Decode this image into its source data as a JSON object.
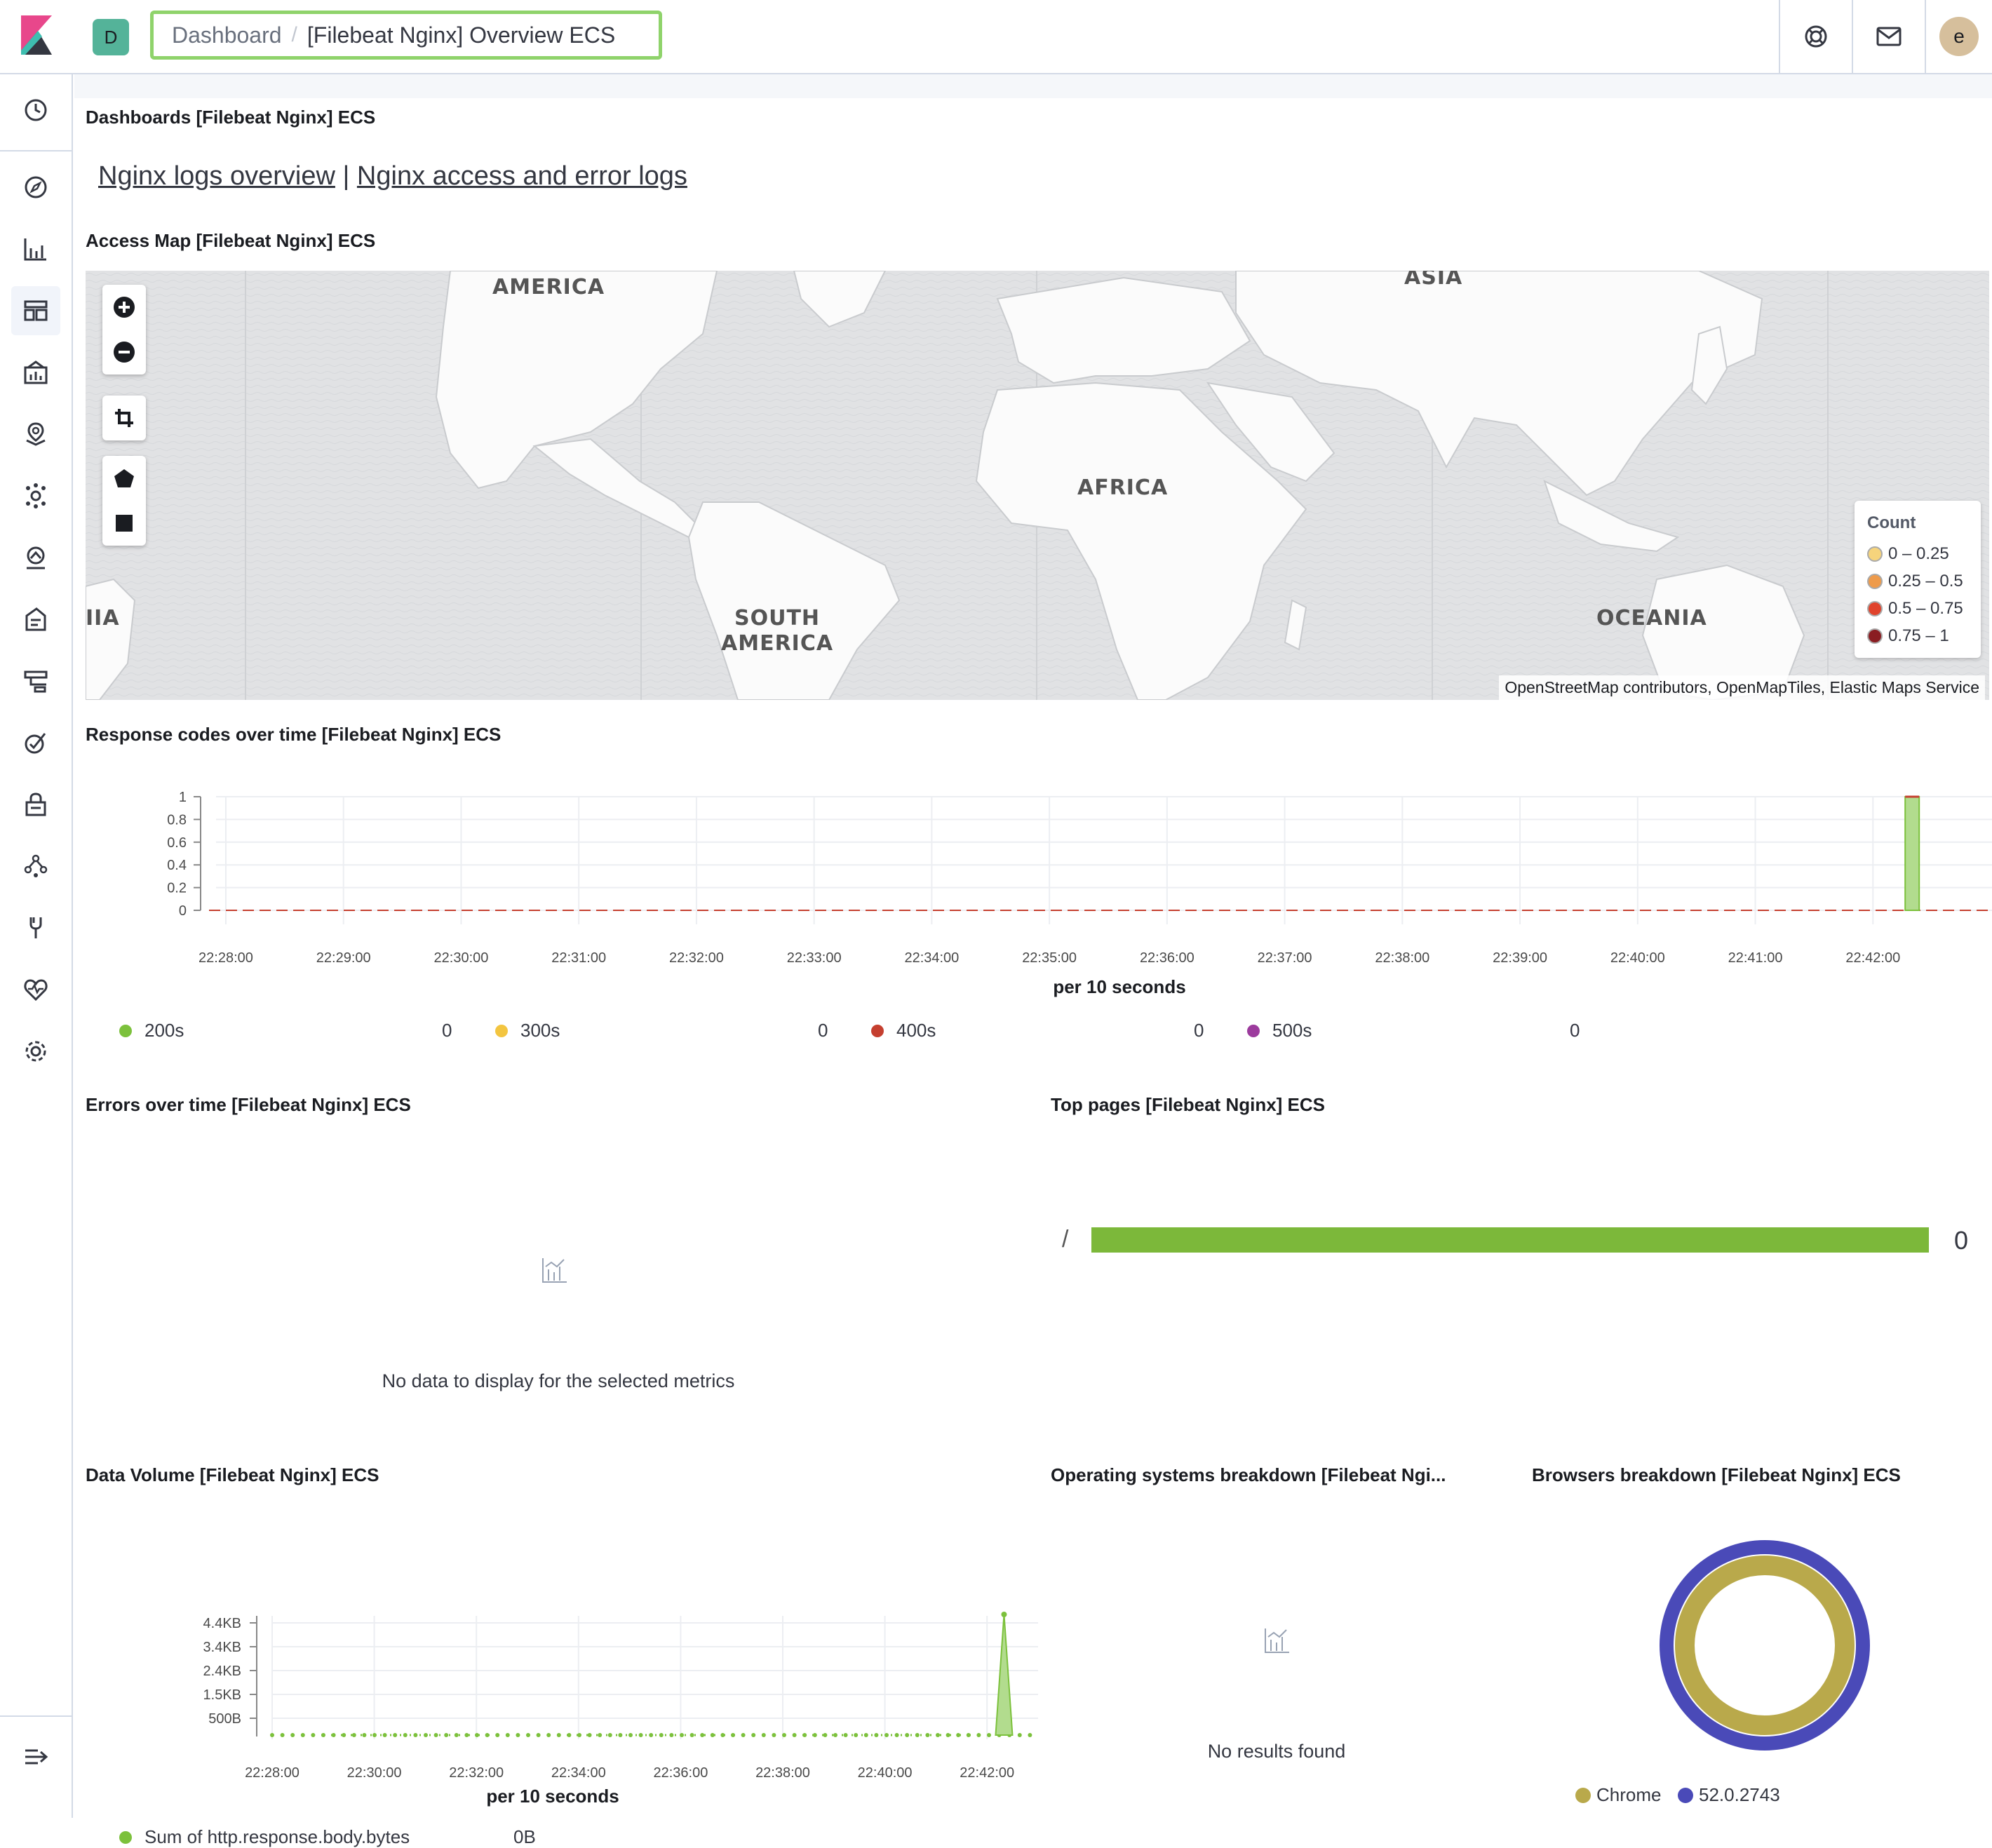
{
  "topbar": {
    "space_initial": "D",
    "breadcrumb_root": "Dashboard",
    "breadcrumb_separator": "/",
    "breadcrumb_current": "[Filebeat Nginx] Overview ECS",
    "user_initial": "e"
  },
  "sidenav": {
    "items": [
      "clock-icon",
      "compass-icon",
      "visualize-icon",
      "dashboard-icon",
      "canvas-icon",
      "maps-icon",
      "ml-icon",
      "infrastructure-icon",
      "logs-icon",
      "apm-icon",
      "uptime-icon",
      "siem-icon",
      "graph-icon",
      "dev-tools-icon",
      "monitoring-icon",
      "management-icon"
    ],
    "collapse_icon": "menu-collapse-icon"
  },
  "panels": {
    "dashboards": {
      "title": "Dashboards [Filebeat Nginx] ECS",
      "link1": "Nginx logs overview",
      "separator": "|",
      "link2": "Nginx access and error logs"
    },
    "map": {
      "title": "Access Map [Filebeat Nginx] ECS",
      "labels": {
        "north_america": "AMERICA",
        "asia": "ASIA",
        "africa": "AFRICA",
        "south_america": "SOUTH\nAMERICA",
        "oceania": "OCEANIA",
        "west_edge": "IIA"
      },
      "legend_title": "Count",
      "legend": [
        {
          "label": "0 – 0.25",
          "color": "#f6d47c"
        },
        {
          "label": "0.25 – 0.5",
          "color": "#ee9b4b"
        },
        {
          "label": "0.5 – 0.75",
          "color": "#e0432c"
        },
        {
          "label": "0.75 – 1",
          "color": "#8a1d22"
        }
      ],
      "attribution": "OpenStreetMap contributors, OpenMapTiles, Elastic Maps Service"
    },
    "response_codes": {
      "title": "Response codes over time [Filebeat Nginx] ECS",
      "xlabel": "per 10 seconds",
      "legend": [
        {
          "label": "200s",
          "value": "0",
          "color": "#7cc13c"
        },
        {
          "label": "300s",
          "value": "0",
          "color": "#f3c540"
        },
        {
          "label": "400s",
          "value": "0",
          "color": "#c53f2f"
        },
        {
          "label": "500s",
          "value": "0",
          "color": "#9c3b9d"
        }
      ]
    },
    "errors": {
      "title": "Errors over time [Filebeat Nginx] ECS",
      "empty_message": "No data to display for the selected metrics"
    },
    "top_pages": {
      "title": "Top pages [Filebeat Nginx] ECS",
      "rows": [
        {
          "label": "/",
          "value": "0"
        }
      ]
    },
    "data_volume": {
      "title": "Data Volume [Filebeat Nginx] ECS",
      "xlabel": "per 10 seconds",
      "legend_label": "Sum of http.response.body.bytes",
      "legend_value": "0B"
    },
    "os": {
      "title": "Operating systems breakdown [Filebeat Ngi...",
      "empty_message": "No results found"
    },
    "browsers": {
      "title": "Browsers breakdown [Filebeat Nginx] ECS",
      "legend": [
        {
          "label": "Chrome",
          "color": "#b9a94b"
        },
        {
          "label": "52.0.2743",
          "color": "#4a4ab8"
        }
      ]
    }
  },
  "chart_data": [
    {
      "type": "bar",
      "title": "Response codes over time [Filebeat Nginx] ECS",
      "xlabel": "per 10 seconds",
      "ylabel": "",
      "ylim": [
        0,
        1
      ],
      "yticks": [
        "0",
        "0.2",
        "0.4",
        "0.6",
        "0.8",
        "1"
      ],
      "x": [
        "22:28:00",
        "22:29:00",
        "22:30:00",
        "22:31:00",
        "22:32:00",
        "22:33:00",
        "22:34:00",
        "22:35:00",
        "22:36:00",
        "22:37:00",
        "22:38:00",
        "22:39:00",
        "22:40:00",
        "22:41:00",
        "22:42:00"
      ],
      "series": [
        {
          "name": "200s",
          "points": [
            {
              "x": "22:42:20",
              "y": 1
            }
          ]
        },
        {
          "name": "400s",
          "points": [
            {
              "x": "22:42:20",
              "y": 0
            }
          ]
        }
      ]
    },
    {
      "type": "area",
      "title": "Data Volume [Filebeat Nginx] ECS",
      "xlabel": "per 10 seconds",
      "ylabel": "",
      "yticks": [
        "500B",
        "1.5KB",
        "2.4KB",
        "3.4KB",
        "4.4KB"
      ],
      "x": [
        "22:28:00",
        "22:30:00",
        "22:32:00",
        "22:34:00",
        "22:36:00",
        "22:38:00",
        "22:40:00",
        "22:42:00"
      ],
      "series": [
        {
          "name": "Sum of http.response.body.bytes",
          "points": [
            {
              "x": "22:42:20",
              "y": 4.4,
              "unit": "KB"
            }
          ]
        }
      ]
    },
    {
      "type": "pie",
      "title": "Browsers breakdown [Filebeat Nginx] ECS",
      "slices": [
        {
          "name": "Chrome",
          "value": 1
        },
        {
          "name": "52.0.2743",
          "value": 1
        }
      ]
    }
  ]
}
